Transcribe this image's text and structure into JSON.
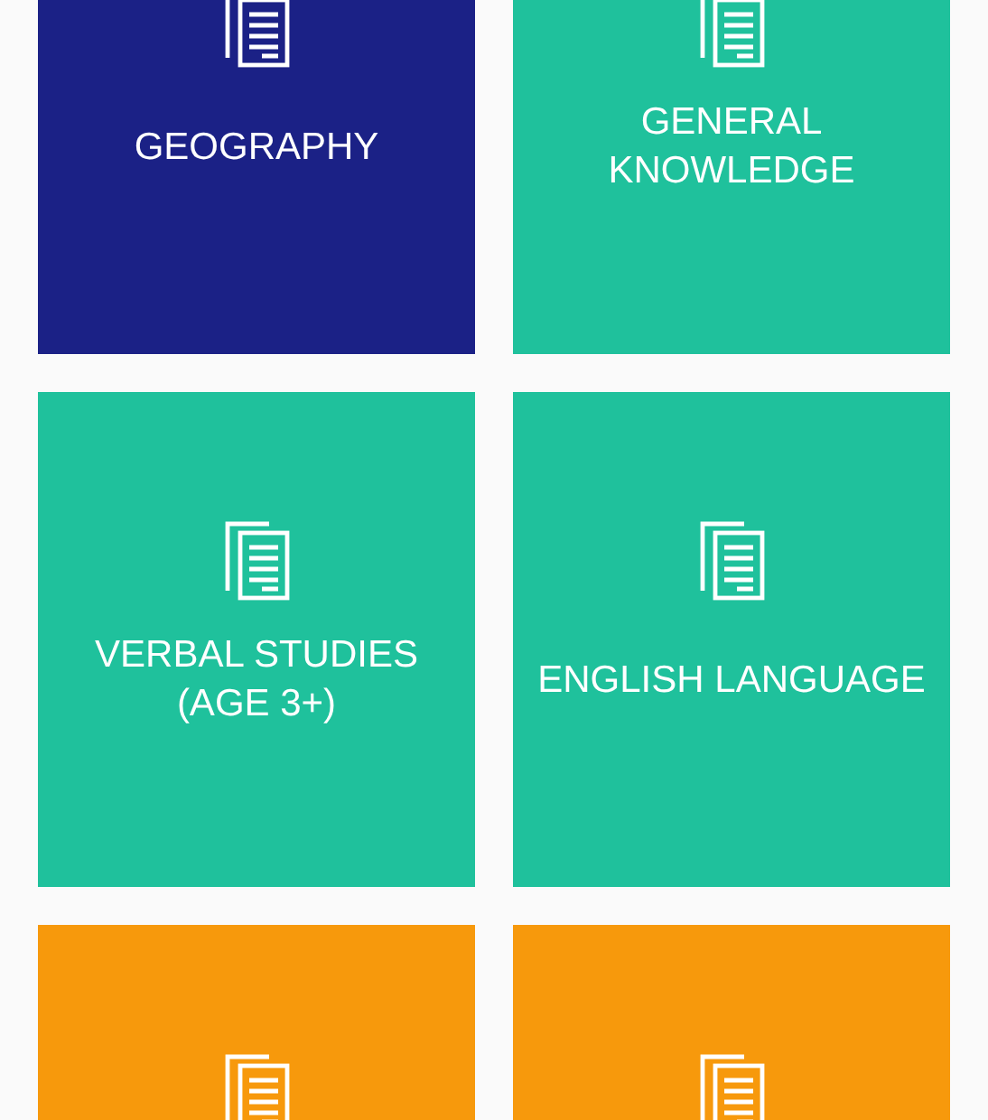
{
  "tiles": [
    {
      "label": "GEOGRAPHY",
      "color": "#1b2186"
    },
    {
      "label": "GENERAL KNOWLEDGE",
      "color": "#1fc19c"
    },
    {
      "label": "VERBAL STUDIES (AGE 3+)",
      "color": "#1fc19c"
    },
    {
      "label": "ENGLISH LANGUAGE",
      "color": "#1fc19c"
    },
    {
      "color": "#f7990c"
    },
    {
      "color": "#f7990c"
    }
  ]
}
